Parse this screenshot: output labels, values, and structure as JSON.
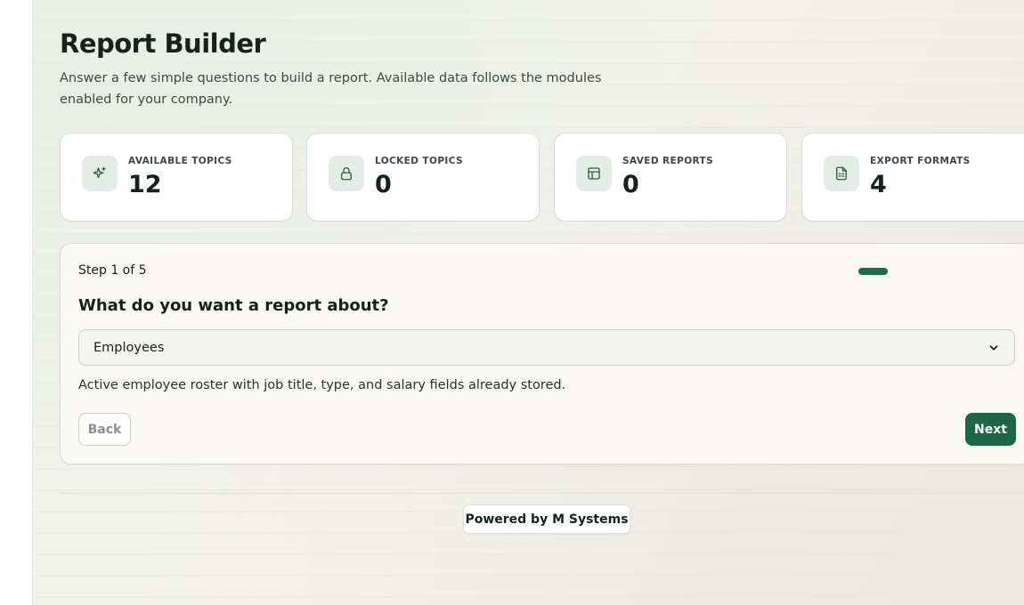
{
  "header": {
    "title": "Report Builder",
    "subtitle": "Answer a few simple questions to build a report. Available data follows the modules enabled for your company."
  },
  "stats": [
    {
      "label": "AVAILABLE TOPICS",
      "value": "12",
      "icon": "sparkles-icon"
    },
    {
      "label": "LOCKED TOPICS",
      "value": "0",
      "icon": "lock-icon"
    },
    {
      "label": "SAVED REPORTS",
      "value": "0",
      "icon": "table-icon"
    },
    {
      "label": "EXPORT FORMATS",
      "value": "4",
      "icon": "file-spreadsheet-icon"
    }
  ],
  "wizard": {
    "step_label": "Step 1 of 5",
    "progress": {
      "current": 1,
      "total": 5
    },
    "question": "What do you want a report about?",
    "selected_topic": "Employees",
    "description": "Active employee roster with job title, type, and salary fields already stored.",
    "back_label": "Back",
    "next_label": "Next"
  },
  "footer": {
    "powered_by": "Powered by M Systems"
  },
  "colors": {
    "accent": "#1d6646",
    "icon_bg": "#e4ece7"
  }
}
